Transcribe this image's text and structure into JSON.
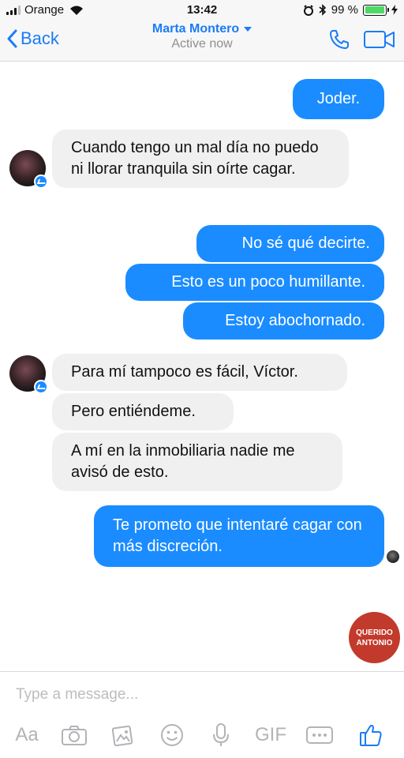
{
  "status_bar": {
    "carrier": "Orange",
    "time": "13:42",
    "battery": "99 %",
    "battery_level": 0.99
  },
  "header": {
    "back_label": "Back",
    "contact_name": "Marta Montero",
    "contact_status": "Active now"
  },
  "messages": [
    {
      "direction": "out",
      "text": "Joder."
    },
    {
      "direction": "in",
      "text": "Cuando tengo un mal día no puedo ni llorar tranquila sin oírte cagar."
    },
    {
      "direction": "out",
      "text": "No sé qué decirte."
    },
    {
      "direction": "out",
      "text": "Esto es un poco humillante."
    },
    {
      "direction": "out",
      "text": "Estoy abochornado."
    },
    {
      "direction": "in",
      "text": "Para mí tampoco es fácil, Víctor."
    },
    {
      "direction": "in",
      "text": "Pero entiéndeme."
    },
    {
      "direction": "in",
      "text": "A mí en la inmobiliaria nadie me avisó de esto."
    },
    {
      "direction": "out",
      "text": "Te prometo que intentaré cagar con más discreción."
    }
  ],
  "watermark": {
    "line1": "QUERIDO",
    "line2": "ANTONIO"
  },
  "composer": {
    "placeholder": "Type a message...",
    "text_tool_label": "Aa",
    "gif_label": "GIF"
  },
  "colors": {
    "accent": "#1a7cf5",
    "outgoing_bubble": "#1a8cff",
    "incoming_bubble": "#f1f0f0",
    "toolbar_icon": "#b3b3b8",
    "watermark": "#c23a2b"
  },
  "icons": {
    "header": [
      "chevron-left-icon",
      "phone-icon",
      "video-camera-icon"
    ],
    "toolbar": [
      "camera-icon",
      "gallery-icon",
      "emoji-icon",
      "microphone-icon",
      "more-icon",
      "thumbs-up-icon"
    ]
  }
}
